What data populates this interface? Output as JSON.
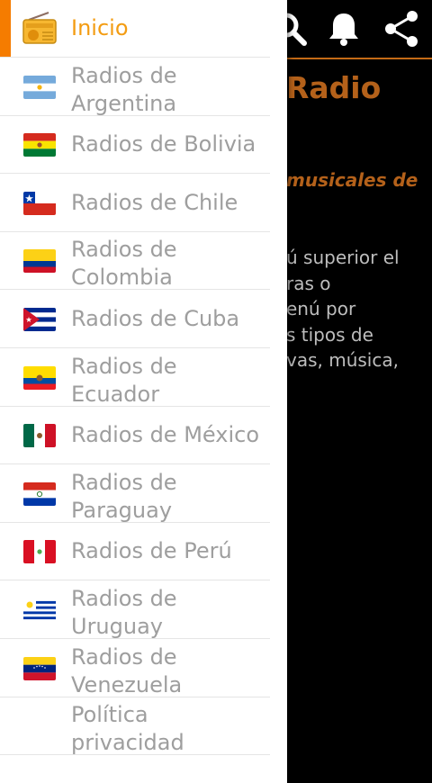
{
  "background": {
    "title": "Radio",
    "subtitle": "musicales de",
    "body_lines": [
      "ú superior el",
      "ras o",
      "enú por",
      "s tipos de",
      "vas, música,"
    ]
  },
  "toolbar_icons": [
    "search-icon",
    "bell-icon",
    "share-icon"
  ],
  "drawer": {
    "items": [
      {
        "label": "Inicio",
        "icon": "radio-icon",
        "active": true
      },
      {
        "label_lines": [
          "Radios de",
          "Argentina"
        ],
        "icon": "flag-argentina"
      },
      {
        "label": "Radios de Bolivia",
        "icon": "flag-bolivia"
      },
      {
        "label": "Radios de Chile",
        "icon": "flag-chile"
      },
      {
        "label_lines": [
          "Radios de",
          "Colombia"
        ],
        "icon": "flag-colombia"
      },
      {
        "label": "Radios de Cuba",
        "icon": "flag-cuba"
      },
      {
        "label_lines": [
          "Radios de",
          "Ecuador"
        ],
        "icon": "flag-ecuador"
      },
      {
        "label": "Radios de México",
        "icon": "flag-mexico"
      },
      {
        "label_lines": [
          "Radios de",
          "Paraguay"
        ],
        "icon": "flag-paraguay"
      },
      {
        "label": "Radios de Perú",
        "icon": "flag-peru"
      },
      {
        "label_lines": [
          "Radios de",
          "Uruguay"
        ],
        "icon": "flag-uruguay"
      },
      {
        "label_lines": [
          "Radios de",
          "Venezuela"
        ],
        "icon": "flag-venezuela"
      },
      {
        "label_lines": [
          "Política",
          "privacidad"
        ],
        "icon": ""
      }
    ]
  },
  "colors": {
    "accent": "#f57c00",
    "active_text": "#f39c12",
    "inactive_text": "#9e9e9e",
    "bg_accent": "#b4611a"
  }
}
